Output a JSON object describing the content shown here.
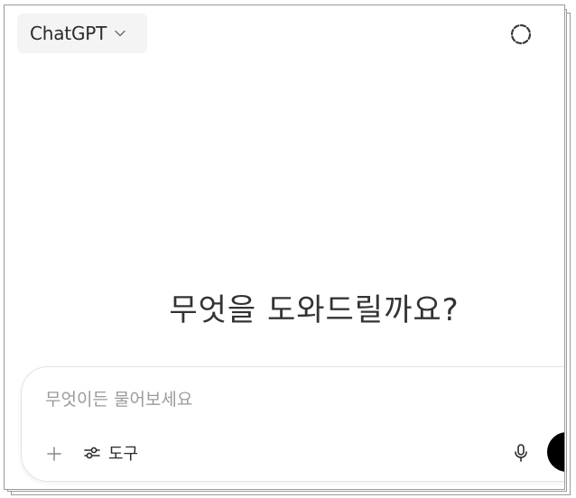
{
  "header": {
    "model_name": "ChatGPT",
    "model_chevron_icon": "chevron-down-icon",
    "temporary_chat_icon": "dashed-circle-icon"
  },
  "main": {
    "headline": "무엇을 도와드릴까요?"
  },
  "composer": {
    "placeholder": "무엇이든 물어보세요",
    "value": "",
    "plus_icon": "plus-icon",
    "tools_icon": "sliders-icon",
    "tools_label": "도구",
    "mic_icon": "microphone-icon",
    "voice_icon": "voice-mode-icon"
  },
  "colors": {
    "text": "#2b2b2b",
    "placeholder": "#9b9b9b",
    "switcher_bg": "#f4f4f4",
    "voice_button": "#000000",
    "border": "#e3e3e3"
  }
}
